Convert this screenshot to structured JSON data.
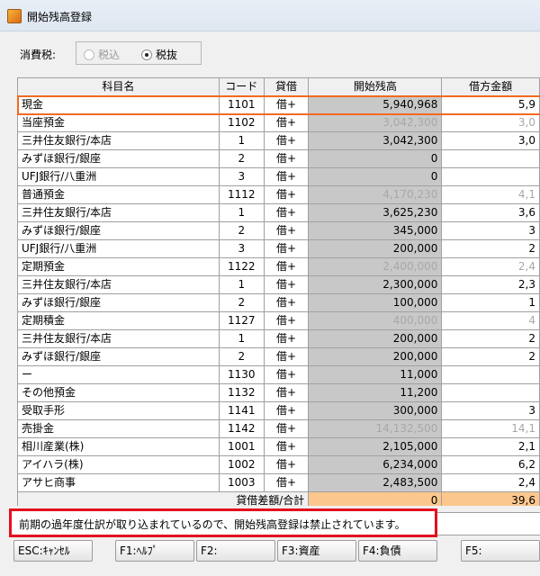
{
  "window": {
    "title": "開始残高登録"
  },
  "tax": {
    "label": "消費税:",
    "options": [
      {
        "label": "税込",
        "selected": false,
        "enabled": false
      },
      {
        "label": "税抜",
        "selected": true,
        "enabled": true
      }
    ]
  },
  "grid": {
    "headers": [
      "科目名",
      "コード",
      "貸借",
      "開始残高",
      "借方金額"
    ],
    "rows": [
      {
        "name": "現金",
        "code": "1101",
        "side": "借+",
        "balance": "5,940,968",
        "debit": "5,9",
        "sub": false,
        "gray": false,
        "selected": true
      },
      {
        "name": "当座預金",
        "code": "1102",
        "side": "借+",
        "balance": "3,042,300",
        "debit": "3,0",
        "sub": false,
        "gray": true
      },
      {
        "name": "三井住友銀行/本店",
        "code": "1",
        "side": "借+",
        "balance": "3,042,300",
        "debit": "3,0",
        "sub": true,
        "gray": false
      },
      {
        "name": "みずほ銀行/銀座",
        "code": "2",
        "side": "借+",
        "balance": "0",
        "debit": "",
        "sub": true,
        "gray": false
      },
      {
        "name": "UFJ銀行/八重洲",
        "code": "3",
        "side": "借+",
        "balance": "0",
        "debit": "",
        "sub": true,
        "gray": false
      },
      {
        "name": "普通預金",
        "code": "1112",
        "side": "借+",
        "balance": "4,170,230",
        "debit": "4,1",
        "sub": false,
        "gray": true
      },
      {
        "name": "三井住友銀行/本店",
        "code": "1",
        "side": "借+",
        "balance": "3,625,230",
        "debit": "3,6",
        "sub": true,
        "gray": false
      },
      {
        "name": "みずほ銀行/銀座",
        "code": "2",
        "side": "借+",
        "balance": "345,000",
        "debit": "3",
        "sub": true,
        "gray": false
      },
      {
        "name": "UFJ銀行/八重洲",
        "code": "3",
        "side": "借+",
        "balance": "200,000",
        "debit": "2",
        "sub": true,
        "gray": false
      },
      {
        "name": "定期預金",
        "code": "1122",
        "side": "借+",
        "balance": "2,400,000",
        "debit": "2,4",
        "sub": false,
        "gray": true
      },
      {
        "name": "三井住友銀行/本店",
        "code": "1",
        "side": "借+",
        "balance": "2,300,000",
        "debit": "2,3",
        "sub": true,
        "gray": false
      },
      {
        "name": "みずほ銀行/銀座",
        "code": "2",
        "side": "借+",
        "balance": "100,000",
        "debit": "1",
        "sub": true,
        "gray": false
      },
      {
        "name": "定期積金",
        "code": "1127",
        "side": "借+",
        "balance": "400,000",
        "debit": "4",
        "sub": false,
        "gray": true
      },
      {
        "name": "三井住友銀行/本店",
        "code": "1",
        "side": "借+",
        "balance": "200,000",
        "debit": "2",
        "sub": true,
        "gray": false
      },
      {
        "name": "みずほ銀行/銀座",
        "code": "2",
        "side": "借+",
        "balance": "200,000",
        "debit": "2",
        "sub": true,
        "gray": false
      },
      {
        "name": "ー",
        "code": "1130",
        "side": "借+",
        "balance": "11,000",
        "debit": "",
        "sub": false,
        "gray": false
      },
      {
        "name": "その他預金",
        "code": "1132",
        "side": "借+",
        "balance": "11,200",
        "debit": "",
        "sub": false,
        "gray": false
      },
      {
        "name": "受取手形",
        "code": "1141",
        "side": "借+",
        "balance": "300,000",
        "debit": "3",
        "sub": false,
        "gray": false
      },
      {
        "name": "売掛金",
        "code": "1142",
        "side": "借+",
        "balance": "14,132,500",
        "debit": "14,1",
        "sub": false,
        "gray": true
      },
      {
        "name": "相川産業(株)",
        "code": "1001",
        "side": "借+",
        "balance": "2,105,000",
        "debit": "2,1",
        "sub": true,
        "gray": false
      },
      {
        "name": "アイハラ(株)",
        "code": "1002",
        "side": "借+",
        "balance": "6,234,000",
        "debit": "6,2",
        "sub": true,
        "gray": false
      },
      {
        "name": "アサヒ商事",
        "code": "1003",
        "side": "借+",
        "balance": "2,483,500",
        "debit": "2,4",
        "sub": true,
        "gray": false
      }
    ],
    "total": {
      "label": "貸借差額/合計",
      "balance": "0",
      "debit": "39,6"
    }
  },
  "message": {
    "text": "前期の過年度仕訳が取り込まれているので、開始残高登録は禁止されています。"
  },
  "fkeys": [
    {
      "label": "ESC:ｷｬﾝｾﾙ"
    },
    {
      "label": "F1:ﾍﾙﾌﾟ"
    },
    {
      "label": "F2:"
    },
    {
      "label": "F3:資産"
    },
    {
      "label": "F4:負債"
    },
    {
      "label": "F5:"
    }
  ],
  "colors": {
    "selection": "#f36a1f",
    "alert": "#e3101f",
    "total_highlight": "#fcc78d",
    "balance_cell": "#c8c8c8"
  }
}
